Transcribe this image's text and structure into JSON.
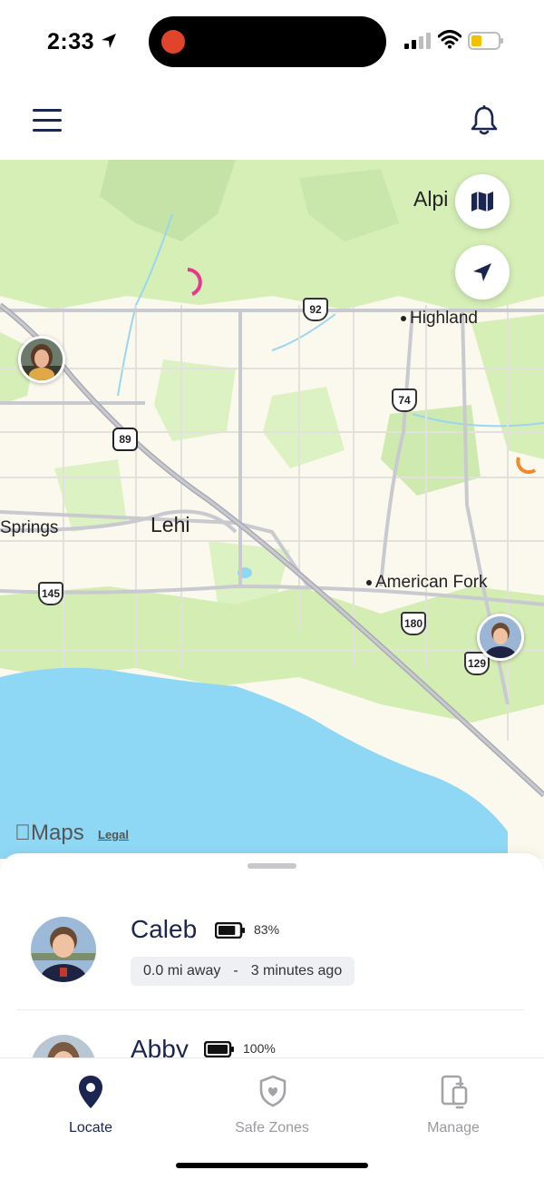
{
  "status_bar": {
    "time": "2:33"
  },
  "header": {
    "menu_icon": "hamburger-menu-icon",
    "notification_icon": "bell-icon"
  },
  "map": {
    "labels": {
      "alpine": "Alpi",
      "highland": "Highland",
      "springs": "Springs",
      "lehi": "Lehi",
      "american_fork": "American Fork"
    },
    "route_shields": [
      "92",
      "74",
      "89",
      "145",
      "180",
      "129"
    ],
    "controls": {
      "map_type_icon": "map-icon",
      "recenter_icon": "navigation-arrow-icon"
    },
    "attribution": {
      "brand": "Maps",
      "legal": "Legal"
    }
  },
  "members": [
    {
      "name": "Caleb",
      "battery_pct": "83%",
      "battery_level": 0.83,
      "distance": "0.0 mi away",
      "separator": "-",
      "last_seen": "3 minutes ago"
    },
    {
      "name": "Abby",
      "battery_pct": "100%",
      "battery_level": 1.0
    }
  ],
  "tabs": [
    {
      "label": "Locate",
      "icon": "location-pin-icon",
      "active": true
    },
    {
      "label": "Safe Zones",
      "icon": "shield-heart-icon",
      "active": false
    },
    {
      "label": "Manage",
      "icon": "devices-icon",
      "active": false
    }
  ],
  "colors": {
    "primary": "#1a2550",
    "water": "#8fd8f5",
    "park": "#d6efb7",
    "land": "#fbf8ee"
  }
}
